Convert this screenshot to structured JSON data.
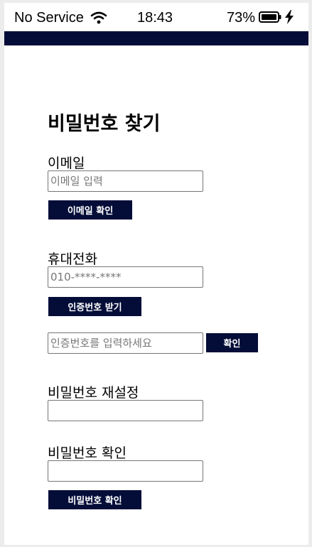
{
  "status_bar": {
    "carrier": "No Service",
    "time": "18:43",
    "battery": "73%"
  },
  "page": {
    "title": "비밀번호 찾기"
  },
  "email": {
    "label": "이메일",
    "placeholder": "이메일 입력",
    "button": "이메일 확인"
  },
  "phone": {
    "label": "휴대전화",
    "placeholder": "010-****-****",
    "button": "인증번호 받기"
  },
  "verification": {
    "placeholder": "인증번호를 입력하세요",
    "button": "확인"
  },
  "reset": {
    "label": "비밀번호 재설정",
    "value": ""
  },
  "confirm": {
    "label": "비밀번호 확인",
    "value": "",
    "button": "비밀번호 확인"
  },
  "colors": {
    "accent": "#030d38"
  }
}
